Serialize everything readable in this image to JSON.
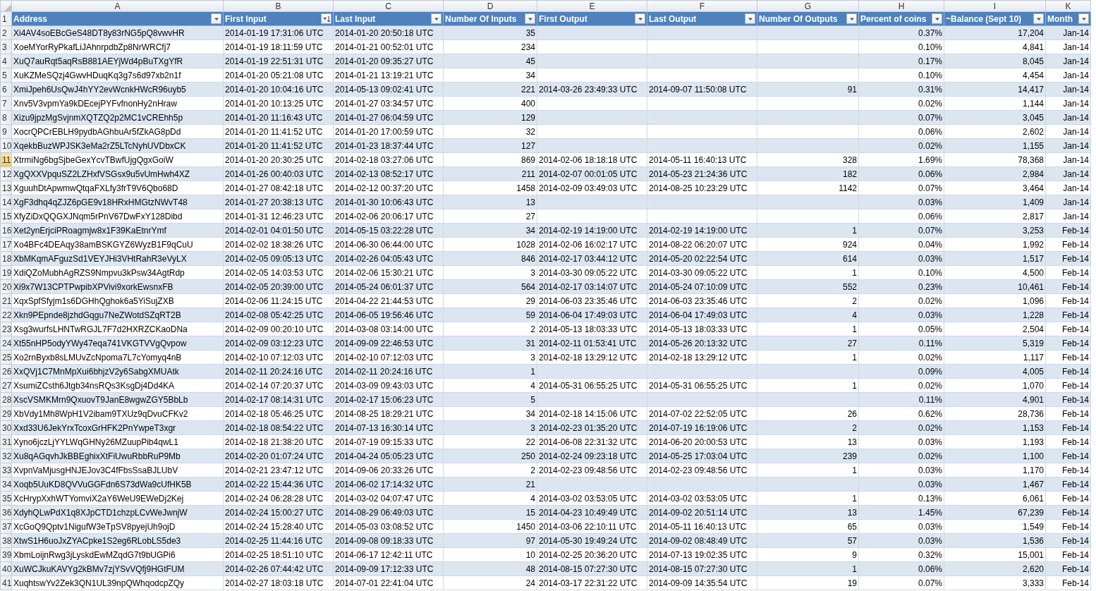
{
  "sheet": {
    "column_letters": [
      "A",
      "B",
      "C",
      "D",
      "E",
      "F",
      "G",
      "H",
      "I",
      "K"
    ],
    "header_row_number": "1",
    "columns": [
      {
        "label": "Address",
        "kind": "text",
        "sorted": false
      },
      {
        "label": "First Input",
        "kind": "text",
        "sorted": true
      },
      {
        "label": "Last Input",
        "kind": "text",
        "sorted": false
      },
      {
        "label": "Number Of Inputs",
        "kind": "number",
        "sorted": false
      },
      {
        "label": "First Output",
        "kind": "text",
        "sorted": false
      },
      {
        "label": "Last Output",
        "kind": "text",
        "sorted": false
      },
      {
        "label": "Number Of Outputs",
        "kind": "number",
        "sorted": false
      },
      {
        "label": "Percent of coins",
        "kind": "number",
        "sorted": false
      },
      {
        "label": "~Balance (Sept 10)",
        "kind": "number",
        "sorted": false
      },
      {
        "label": "Month",
        "kind": "number",
        "sorted": false
      }
    ],
    "rows": [
      {
        "number": "2",
        "selected": false,
        "cells": [
          "Xi4AV4soEBcGeS48DT8y83rNG5pQ8vwvHR",
          "2014-01-19 17:31:06 UTC",
          "2014-01-20 20:50:18 UTC",
          "35",
          null,
          null,
          null,
          "0.37%",
          "17,204",
          "Jan-14"
        ]
      },
      {
        "number": "3",
        "selected": false,
        "cells": [
          "XoeMYorRyPkafLiJAhnrpdbZp8NrWRCfj7",
          "2014-01-19 18:11:59 UTC",
          "2014-01-21 00:52:01 UTC",
          "234",
          null,
          null,
          null,
          "0.10%",
          "4,841",
          "Jan-14"
        ]
      },
      {
        "number": "4",
        "selected": false,
        "cells": [
          "XuQ7auRqt5aqRsB881AEYjWd4pBuTXgYfR",
          "2014-01-19 22:51:31 UTC",
          "2014-01-20 09:35:27 UTC",
          "45",
          null,
          null,
          null,
          "0.17%",
          "8,045",
          "Jan-14"
        ]
      },
      {
        "number": "5",
        "selected": false,
        "cells": [
          "XuKZMeSQzj4GwvHDuqKq3g7s6d97xb2n1f",
          "2014-01-20 05:21:08 UTC",
          "2014-01-21 13:19:21 UTC",
          "34",
          null,
          null,
          null,
          "0.10%",
          "4,454",
          "Jan-14"
        ]
      },
      {
        "number": "6",
        "selected": false,
        "cells": [
          "XmiJpeh6UsQwJ4hYY2evWcnkHWcR96uyb5",
          "2014-01-20 10:04:16 UTC",
          "2014-05-13 09:02:41 UTC",
          "221",
          "2014-03-26 23:49:33 UTC",
          "2014-09-07 11:50:08 UTC",
          "91",
          "0.31%",
          "14,417",
          "Jan-14"
        ]
      },
      {
        "number": "7",
        "selected": false,
        "cells": [
          "Xnv5V3vpmYa9kDEcejPYFvfnonHy2nHraw",
          "2014-01-20 10:13:25 UTC",
          "2014-01-27 03:34:57 UTC",
          "400",
          null,
          null,
          null,
          "0.02%",
          "1,144",
          "Jan-14"
        ]
      },
      {
        "number": "8",
        "selected": false,
        "cells": [
          "Xizu9jpzMgSvjnmXQTZQ2p2MC1vCREhh5p",
          "2014-01-20 11:16:43 UTC",
          "2014-01-27 06:04:59 UTC",
          "129",
          null,
          null,
          null,
          "0.07%",
          "3,045",
          "Jan-14"
        ]
      },
      {
        "number": "9",
        "selected": false,
        "cells": [
          "XocrQPCrEBLH9pydbAGhbuAr5fZkAG8pDd",
          "2014-01-20 11:41:52 UTC",
          "2014-01-20 17:00:59 UTC",
          "32",
          null,
          null,
          null,
          "0.06%",
          "2,602",
          "Jan-14"
        ]
      },
      {
        "number": "10",
        "selected": false,
        "cells": [
          "XqekbBuzWPJSK3eMa2rZ5LTcNyhUVDbxCK",
          "2014-01-20 11:41:52 UTC",
          "2014-01-23 18:37:44 UTC",
          "127",
          null,
          null,
          null,
          "0.02%",
          "1,155",
          "Jan-14"
        ]
      },
      {
        "number": "11",
        "selected": true,
        "cells": [
          "XtrmiNg6bgSjbeGexYcvTBwfUjgQgxGoiW",
          "2014-01-20 20:30:25 UTC",
          "2014-02-18 03:27:06 UTC",
          "869",
          "2014-02-06 18:18:18 UTC",
          "2014-05-11 16:40:13 UTC",
          "328",
          "1.69%",
          "78,368",
          "Jan-14"
        ]
      },
      {
        "number": "12",
        "selected": false,
        "cells": [
          "XgQXXVpquSZ2LZHxfVSGsx9u5vUmHwh4XZ",
          "2014-01-26 00:40:03 UTC",
          "2014-02-13 08:52:17 UTC",
          "211",
          "2014-02-07 00:01:05 UTC",
          "2014-05-23 21:24:36 UTC",
          "182",
          "0.06%",
          "2,984",
          "Jan-14"
        ]
      },
      {
        "number": "13",
        "selected": false,
        "cells": [
          "XguuhDtApwmwQtqaFXLfy3frT9V6Qbo68D",
          "2014-01-27 08:42:18 UTC",
          "2014-02-12 00:37:20 UTC",
          "1458",
          "2014-02-09 03:49:03 UTC",
          "2014-08-25 10:23:29 UTC",
          "1142",
          "0.07%",
          "3,464",
          "Jan-14"
        ]
      },
      {
        "number": "14",
        "selected": false,
        "cells": [
          "XgF3dhq4qZJZ6pGE9v18HRxHMGtzNWvT48",
          "2014-01-27 20:38:13 UTC",
          "2014-01-30 10:06:43 UTC",
          "13",
          null,
          null,
          null,
          "0.03%",
          "1,409",
          "Jan-14"
        ]
      },
      {
        "number": "15",
        "selected": false,
        "cells": [
          "XfyZiDxQQGXJNqm5rPnV67DwFxY128Dibd",
          "2014-01-31 12:46:23 UTC",
          "2014-02-06 20:06:17 UTC",
          "27",
          null,
          null,
          null,
          "0.06%",
          "2,817",
          "Jan-14"
        ]
      },
      {
        "number": "16",
        "selected": false,
        "cells": [
          "Xet2ynErjciPRoagmjw8x1F39KaEtnrYmf",
          "2014-02-01 04:01:50 UTC",
          "2014-05-15 03:22:28 UTC",
          "34",
          "2014-02-19 14:19:00 UTC",
          "2014-02-19 14:19:00 UTC",
          "1",
          "0.07%",
          "3,253",
          "Feb-14"
        ]
      },
      {
        "number": "17",
        "selected": false,
        "cells": [
          "Xo4BFc4DEAqy38amBSKGYZ6WyzB1F9qCuU",
          "2014-02-02 18:38:26 UTC",
          "2014-06-30 06:44:00 UTC",
          "1028",
          "2014-02-06 16:02:17 UTC",
          "2014-08-22 06:20:07 UTC",
          "924",
          "0.04%",
          "1,992",
          "Feb-14"
        ]
      },
      {
        "number": "18",
        "selected": false,
        "cells": [
          "XbMKqmAFguzSd1VEYJHi3VHtRahR3eVyLX",
          "2014-02-05 09:05:13 UTC",
          "2014-02-26 04:05:43 UTC",
          "846",
          "2014-02-17 03:44:12 UTC",
          "2014-05-20 02:22:54 UTC",
          "614",
          "0.03%",
          "1,517",
          "Feb-14"
        ]
      },
      {
        "number": "19",
        "selected": false,
        "cells": [
          "XdiQZoMubhAgRZS9Nmpvu3kPsw34AgtRdp",
          "2014-02-05 14:03:53 UTC",
          "2014-02-06 15:30:21 UTC",
          "3",
          "2014-03-30 09:05:22 UTC",
          "2014-03-30 09:05:22 UTC",
          "1",
          "0.10%",
          "4,500",
          "Feb-14"
        ]
      },
      {
        "number": "20",
        "selected": false,
        "cells": [
          "Xi9x7W13CPTPwpibXPVivi9xorkEwsnxFB",
          "2014-02-05 20:39:00 UTC",
          "2014-05-24 06:01:37 UTC",
          "564",
          "2014-02-17 03:14:07 UTC",
          "2014-05-24 07:10:09 UTC",
          "552",
          "0.23%",
          "10,461",
          "Feb-14"
        ]
      },
      {
        "number": "21",
        "selected": false,
        "cells": [
          "XqxSpfSfyjm1s6DGHhQghok6a5YiSujZXB",
          "2014-02-06 11:24:15 UTC",
          "2014-04-22 21:44:53 UTC",
          "29",
          "2014-06-03 23:35:46 UTC",
          "2014-06-03 23:35:46 UTC",
          "2",
          "0.02%",
          "1,096",
          "Feb-14"
        ]
      },
      {
        "number": "22",
        "selected": false,
        "cells": [
          "Xkn9PEpnde8jzhdGqgu7NeZWotdSZqRT2B",
          "2014-02-08 05:42:25 UTC",
          "2014-06-05 19:56:46 UTC",
          "59",
          "2014-06-04 17:49:03 UTC",
          "2014-06-04 17:49:03 UTC",
          "4",
          "0.03%",
          "1,228",
          "Feb-14"
        ]
      },
      {
        "number": "23",
        "selected": false,
        "cells": [
          "Xsg3wurfsLHNTwRGJL7F7d2HXRZCKaoDNa",
          "2014-02-09 00:20:10 UTC",
          "2014-03-08 03:14:00 UTC",
          "2",
          "2014-05-13 18:03:33 UTC",
          "2014-05-13 18:03:33 UTC",
          "1",
          "0.05%",
          "2,504",
          "Feb-14"
        ]
      },
      {
        "number": "24",
        "selected": false,
        "cells": [
          "Xt55nHP5odyYWy47eqa741VKGTVVgQvpow",
          "2014-02-09 03:12:23 UTC",
          "2014-09-09 22:46:53 UTC",
          "31",
          "2014-02-11 01:53:41 UTC",
          "2014-05-26 20:13:32 UTC",
          "27",
          "0.11%",
          "5,319",
          "Feb-14"
        ]
      },
      {
        "number": "25",
        "selected": false,
        "cells": [
          "Xo2rnByxb8sLMUvZcNpoma7L7cYomyq4nB",
          "2014-02-10 07:12:03 UTC",
          "2014-02-10 07:12:03 UTC",
          "3",
          "2014-02-18 13:29:12 UTC",
          "2014-02-18 13:29:12 UTC",
          "1",
          "0.02%",
          "1,117",
          "Feb-14"
        ]
      },
      {
        "number": "26",
        "selected": false,
        "cells": [
          "XxQVj1C7MnMpXui6bhjzV2y6SabgXMUAtk",
          "2014-02-11 20:24:16 UTC",
          "2014-02-11 20:24:16 UTC",
          "1",
          null,
          null,
          null,
          "0.09%",
          "4,005",
          "Feb-14"
        ]
      },
      {
        "number": "27",
        "selected": false,
        "cells": [
          "XsumiZCsth6Jtgb34nsRQs3KsgDj4Dd4KA",
          "2014-02-14 07:20:37 UTC",
          "2014-03-09 09:43:03 UTC",
          "4",
          "2014-05-31 06:55:25 UTC",
          "2014-05-31 06:55:25 UTC",
          "1",
          "0.02%",
          "1,070",
          "Feb-14"
        ]
      },
      {
        "number": "28",
        "selected": false,
        "cells": [
          "XscVSMKMrn9QxuovT9JanE8wgwZGY5BbLb",
          "2014-02-17 08:14:31 UTC",
          "2014-02-17 15:06:23 UTC",
          "5",
          null,
          null,
          null,
          "0.11%",
          "4,901",
          "Feb-14"
        ]
      },
      {
        "number": "29",
        "selected": false,
        "cells": [
          "XbVdy1Mh8WpH1V2ibam9TXUz9qDvuCFKv2",
          "2014-02-18 05:46:25 UTC",
          "2014-08-25 18:29:21 UTC",
          "34",
          "2014-02-18 14:15:06 UTC",
          "2014-07-02 22:52:05 UTC",
          "26",
          "0.62%",
          "28,736",
          "Feb-14"
        ]
      },
      {
        "number": "30",
        "selected": false,
        "cells": [
          "Xxd33U6JekYrxTcoxGrHFK2PnYwpeT3xgr",
          "2014-02-18 08:54:22 UTC",
          "2014-07-13 16:30:14 UTC",
          "3",
          "2014-02-23 01:35:20 UTC",
          "2014-07-19 16:19:06 UTC",
          "2",
          "0.02%",
          "1,153",
          "Feb-14"
        ]
      },
      {
        "number": "31",
        "selected": false,
        "cells": [
          "Xyno6jczLjYYLWqGHNy26MZuupPib4qwL1",
          "2014-02-18 21:38:20 UTC",
          "2014-07-19 09:15:33 UTC",
          "22",
          "2014-06-08 22:31:32 UTC",
          "2014-06-20 20:00:53 UTC",
          "13",
          "0.03%",
          "1,193",
          "Feb-14"
        ]
      },
      {
        "number": "32",
        "selected": false,
        "cells": [
          "Xu8qAGqvhJkBBEghixXtFiUwuRbbRuP9Mb",
          "2014-02-20 01:07:24 UTC",
          "2014-04-24 05:05:23 UTC",
          "250",
          "2014-02-24 09:23:18 UTC",
          "2014-05-25 17:03:04 UTC",
          "239",
          "0.02%",
          "1,100",
          "Feb-14"
        ]
      },
      {
        "number": "33",
        "selected": false,
        "cells": [
          "XvpnVaMjusgHNJEJov3C4fFbsSsaBJLUbV",
          "2014-02-21 23:47:12 UTC",
          "2014-09-06 20:33:26 UTC",
          "2",
          "2014-02-23 09:48:56 UTC",
          "2014-02-23 09:48:56 UTC",
          "1",
          "0.03%",
          "1,170",
          "Feb-14"
        ]
      },
      {
        "number": "34",
        "selected": false,
        "cells": [
          "Xoqb5UuKD8QVVuGGFdn6S73dWa9cUfHK5B",
          "2014-02-22 15:44:36 UTC",
          "2014-06-02 17:14:32 UTC",
          "21",
          null,
          null,
          null,
          "0.03%",
          "1,467",
          "Feb-14"
        ]
      },
      {
        "number": "35",
        "selected": false,
        "cells": [
          "XcHrypXxhWTYomviX2aY6WeU9EWeDj2Kej",
          "2014-02-24 06:28:28 UTC",
          "2014-03-02 04:07:47 UTC",
          "4",
          "2014-03-02 03:53:05 UTC",
          "2014-03-02 03:53:05 UTC",
          "1",
          "0.13%",
          "6,061",
          "Feb-14"
        ]
      },
      {
        "number": "36",
        "selected": false,
        "cells": [
          "XdyhQLwPdX1q8XJpCTD1chzpLCvWeJwnjW",
          "2014-02-24 15:00:27 UTC",
          "2014-08-29 06:49:03 UTC",
          "15",
          "2014-04-23 10:49:49 UTC",
          "2014-09-02 20:51:14 UTC",
          "13",
          "1.45%",
          "67,239",
          "Feb-14"
        ]
      },
      {
        "number": "37",
        "selected": false,
        "cells": [
          "XcGoQ9Qptv1NigufW3eTpSV8pyejUh9ojD",
          "2014-02-24 15:28:40 UTC",
          "2014-05-03 03:08:52 UTC",
          "1450",
          "2014-03-06 22:10:11 UTC",
          "2014-05-11 16:40:13 UTC",
          "65",
          "0.03%",
          "1,549",
          "Feb-14"
        ]
      },
      {
        "number": "38",
        "selected": false,
        "cells": [
          "XtwS1H6uoJxZYACpke1S2eg6RLobLS5de3",
          "2014-02-25 11:44:16 UTC",
          "2014-09-08 09:18:33 UTC",
          "97",
          "2014-05-30 19:49:24 UTC",
          "2014-09-02 08:48:49 UTC",
          "57",
          "0.03%",
          "1,536",
          "Feb-14"
        ]
      },
      {
        "number": "39",
        "selected": false,
        "cells": [
          "XbmLoijnRwg3jLyskdEwMZqdG7t9bUGPi6",
          "2014-02-25 18:51:10 UTC",
          "2014-06-17 12:42:11 UTC",
          "10",
          "2014-02-25 20:36:20 UTC",
          "2014-07-13 19:02:35 UTC",
          "9",
          "0.32%",
          "15,001",
          "Feb-14"
        ]
      },
      {
        "number": "40",
        "selected": false,
        "cells": [
          "XuWCJkuKAVYg2kBMv7zjYSvVQfj9HGtFUM",
          "2014-02-26 07:44:42 UTC",
          "2014-09-09 17:12:33 UTC",
          "48",
          "2014-08-15 07:27:30 UTC",
          "2014-08-15 07:27:30 UTC",
          "1",
          "0.06%",
          "2,620",
          "Feb-14"
        ]
      },
      {
        "number": "41",
        "selected": false,
        "cells": [
          "XuqhtswYv2Zek3QN1UL39npQWhqodcpZQy",
          "2014-02-27 18:03:18 UTC",
          "2014-07-01 22:41:04 UTC",
          "24",
          "2014-03-17 22:31:22 UTC",
          "2014-09-09 14:35:54 UTC",
          "19",
          "0.07%",
          "3,333",
          "Feb-14"
        ]
      }
    ]
  }
}
